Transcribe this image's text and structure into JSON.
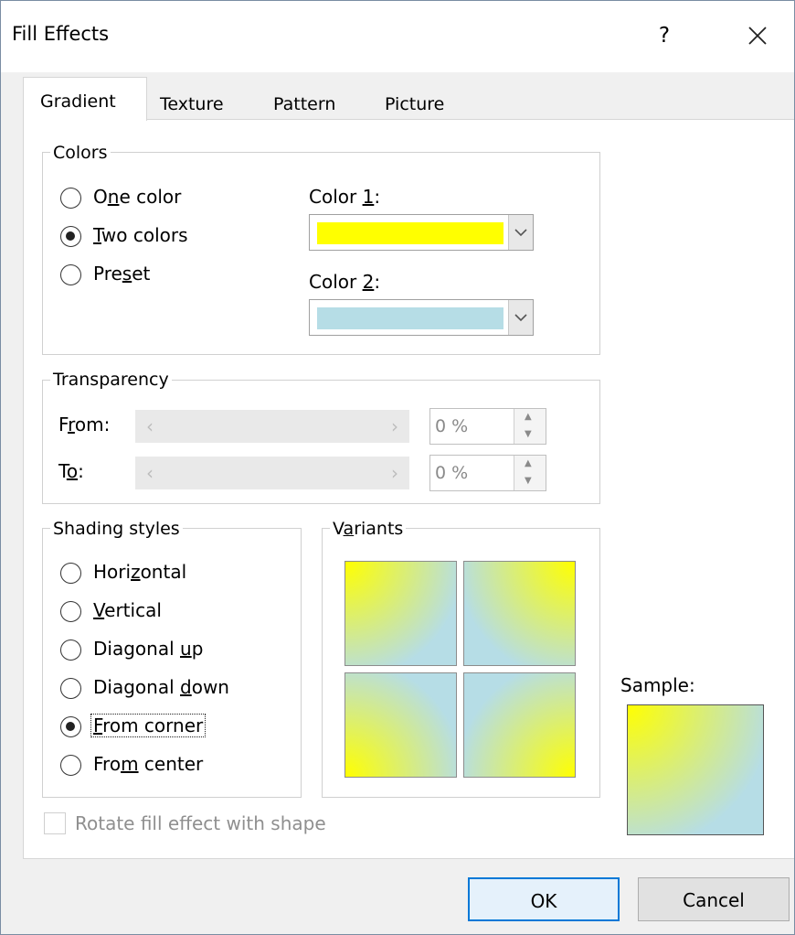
{
  "window": {
    "title": "Fill Effects",
    "help_glyph": "?"
  },
  "tabs": [
    {
      "label": "Gradient",
      "active": true
    },
    {
      "label": "Texture",
      "active": false
    },
    {
      "label": "Pattern",
      "active": false
    },
    {
      "label": "Picture",
      "active": false
    }
  ],
  "colors": {
    "group_label": "Colors",
    "options": [
      {
        "pre": "O",
        "u": "n",
        "post": "e color",
        "selected": false
      },
      {
        "pre": "",
        "u": "T",
        "post": "wo colors",
        "selected": true
      },
      {
        "pre": "Pre",
        "u": "s",
        "post": "et",
        "selected": false
      }
    ],
    "color1": {
      "pre": "Color ",
      "u": "1",
      "post": ":",
      "value": "#ffff00"
    },
    "color2": {
      "pre": "Color ",
      "u": "2",
      "post": ":",
      "value": "#b6dde6"
    }
  },
  "transparency": {
    "group_label": "Transparency",
    "from": {
      "pre": "F",
      "u": "r",
      "post": "om:",
      "value": "0 %"
    },
    "to": {
      "pre": "T",
      "u": "o",
      "post": ":",
      "value": "0 %"
    }
  },
  "shading": {
    "group_label": "Shading styles",
    "options": [
      {
        "pre": "Hori",
        "u": "z",
        "post": "ontal",
        "selected": false
      },
      {
        "pre": "",
        "u": "V",
        "post": "ertical",
        "selected": false
      },
      {
        "pre": "Diagonal ",
        "u": "u",
        "post": "p",
        "selected": false
      },
      {
        "pre": "Diagonal ",
        "u": "d",
        "post": "own",
        "selected": false
      },
      {
        "pre": "",
        "u": "F",
        "post": "rom corner",
        "selected": true
      },
      {
        "pre": "Fro",
        "u": "m",
        "post": " center",
        "selected": false
      }
    ]
  },
  "variants": {
    "pre": "V",
    "u": "a",
    "post": "riants"
  },
  "sample": {
    "label": "Sample:"
  },
  "rotate": {
    "label": "Rotate fill effect with shape",
    "checked": false,
    "enabled": false
  },
  "buttons": {
    "ok": "OK",
    "cancel": "Cancel"
  }
}
